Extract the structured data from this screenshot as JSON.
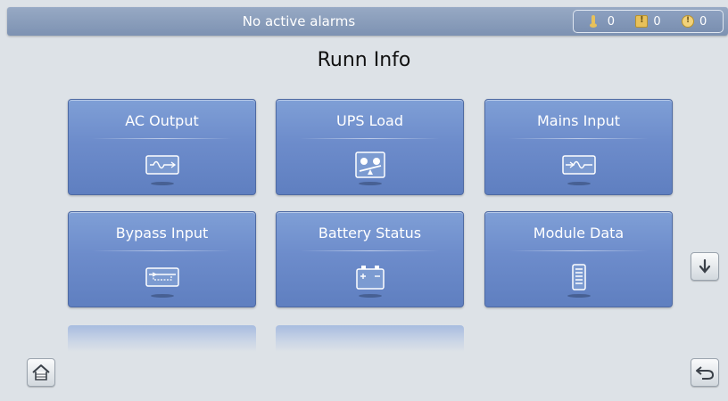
{
  "header": {
    "alarm_status": "No active alarms",
    "counts": {
      "critical": "0",
      "major": "0",
      "minor": "0"
    }
  },
  "page": {
    "title": "Runn Info"
  },
  "tiles": [
    {
      "label": "AC Output",
      "icon": "ac-waveform-icon"
    },
    {
      "label": "UPS Load",
      "icon": "load-icon"
    },
    {
      "label": "Mains Input",
      "icon": "mains-waveform-icon"
    },
    {
      "label": "Bypass Input",
      "icon": "bypass-icon"
    },
    {
      "label": "Battery Status",
      "icon": "battery-icon"
    },
    {
      "label": "Module Data",
      "icon": "module-icon"
    }
  ],
  "nav": {
    "scroll_down_icon": "down-arrow-icon",
    "home_icon": "home-icon",
    "back_icon": "back-arrow-icon"
  },
  "colors": {
    "tile": "#6d8ccb",
    "topbar": "#8a9dbb",
    "background": "#dde2e7",
    "alarm_icon": "#e8c15a"
  }
}
